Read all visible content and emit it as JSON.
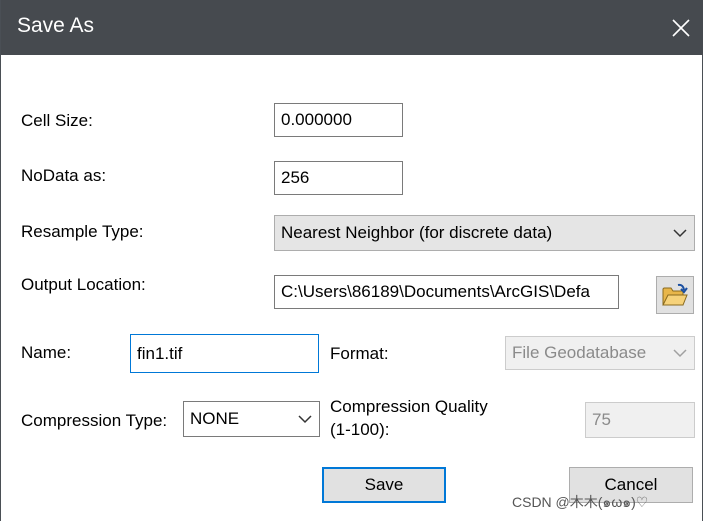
{
  "window": {
    "title": "Save As"
  },
  "fields": {
    "cell_size_label": "Cell Size:",
    "cell_size_value": "0.000000",
    "nodata_label": "NoData as:",
    "nodata_value": "256",
    "resample_label": "Resample Type:",
    "resample_value": "Nearest Neighbor (for discrete data)",
    "output_location_label": "Output Location:",
    "output_location_value": "C:\\Users\\86189\\Documents\\ArcGIS\\Defa",
    "name_label": "Name:",
    "name_value": "fin1.tif",
    "format_label": "Format:",
    "format_value": "File Geodatabase",
    "compression_type_label": "Compression Type:",
    "compression_type_value": "NONE",
    "compression_quality_label_line1": "Compression Quality",
    "compression_quality_label_line2": "(1-100):",
    "compression_quality_value": "75"
  },
  "buttons": {
    "save_label": "Save",
    "cancel_label": "Cancel"
  },
  "watermark": {
    "text": "CSDN @木木(๑ω๑)♡"
  },
  "colors": {
    "titlebar": "#464a4f",
    "focus_accent": "#0078d7",
    "folder_icon": "#e8b64a"
  },
  "icons": {
    "close": "close-icon",
    "dropdown": "chevron-down-icon",
    "browse": "open-folder-icon"
  }
}
